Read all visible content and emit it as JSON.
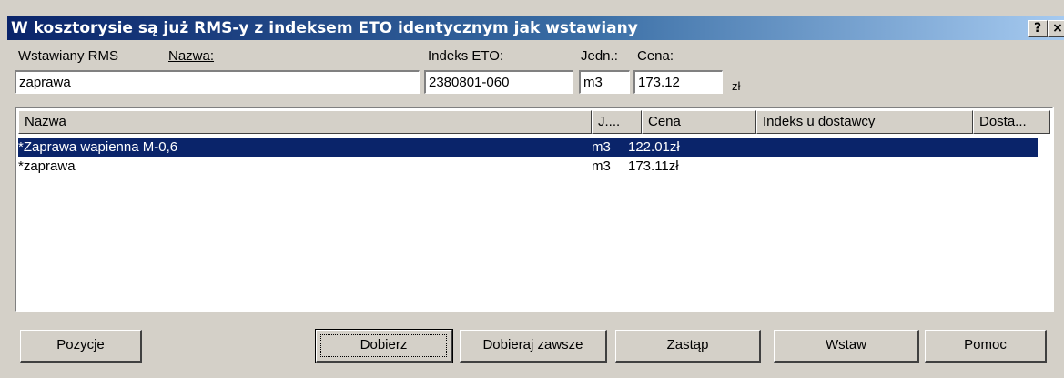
{
  "window": {
    "title": "W kosztorysie są już RMS-y z indeksem ETO identycznym jak wstawiany",
    "help_button": "?",
    "close_button": "×"
  },
  "form": {
    "rms_label": "Wstawiany RMS",
    "name_label": "Nazwa:",
    "name_value": "zaprawa",
    "eto_label": "Indeks ETO:",
    "eto_value": "2380801-060",
    "unit_label": "Jedn.:",
    "unit_value": "m3",
    "price_label": "Cena:",
    "price_value": "173.12",
    "currency": "zł"
  },
  "list": {
    "columns": [
      "Nazwa",
      "J....",
      "Cena",
      "Indeks u dostawcy",
      "Dosta..."
    ],
    "rows": [
      {
        "name": "*Zaprawa wapienna M-0,6",
        "unit": "m3",
        "price": "122.01zł",
        "selected": true
      },
      {
        "name": "*zaprawa",
        "unit": "m3",
        "price": "173.11zł",
        "selected": false
      }
    ]
  },
  "buttons": {
    "positions": "Pozycje",
    "choose": "Dobierz",
    "choose_always": "Dobieraj zawsze",
    "replace": "Zastąp",
    "insert": "Wstaw",
    "help": "Pomoc"
  }
}
